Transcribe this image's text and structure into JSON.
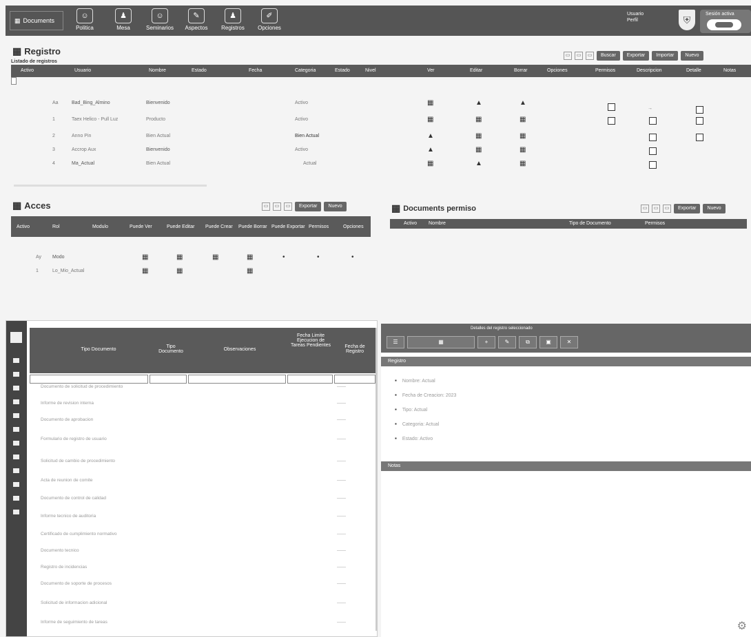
{
  "topbar": {
    "logo_label": "Documents",
    "nav": [
      {
        "label": "Politica",
        "icon": "chat-icon"
      },
      {
        "label": "Mesa",
        "icon": "user-icon"
      },
      {
        "label": "Seminarios",
        "icon": "chat-icon"
      },
      {
        "label": "Aspectos",
        "icon": "edit-icon"
      },
      {
        "label": "Registros",
        "icon": "user-icon"
      },
      {
        "label": "Opciones",
        "icon": "pencil-icon"
      }
    ],
    "right_text": [
      "Usuario",
      "Perfil"
    ],
    "user_label": "Sesión activa"
  },
  "registro": {
    "title": "Registro",
    "subtitle": "Listado de registros",
    "buttons": [
      "Buscar",
      "Exportar",
      "Importar",
      "Nuevo"
    ],
    "columns": [
      "Activo",
      "Usuario",
      "Nombre",
      "Estado",
      "Fecha",
      "Categoria",
      "Estado",
      "Nivel",
      "Ver",
      "Editar",
      "Borrar",
      "Opciones",
      "Permisos",
      "Descripcion",
      "Detalle",
      "Notas"
    ],
    "rows": [
      {
        "a": "Aa",
        "b": "Bad_Bing_Almino",
        "c": "Bienvenido",
        "d": "Activo"
      },
      {
        "a": "1",
        "b": "Taex Helico - Pull Luz",
        "c": "Producto",
        "d": "Activo"
      },
      {
        "a": "2",
        "b": "Anno Pin",
        "c": "Bien Actual",
        "d": "Bien Actual"
      },
      {
        "a": "3",
        "b": "Accrop Aux",
        "c": "Bienvenido",
        "d": "Activo"
      },
      {
        "a": "4",
        "b": "Ma_Actual",
        "c": "Bien Actual",
        "d": "Actual"
      }
    ]
  },
  "acces": {
    "title": "Acces",
    "buttons": [
      "Exportar",
      "Nuevo"
    ],
    "columns": [
      "Activo",
      "Rol",
      "Modulo",
      "Puede Ver",
      "Puede Editar",
      "Puede Crear",
      "Puede Borrar",
      "Puede Exportar",
      "Permisos",
      "Opciones"
    ],
    "rows": [
      {
        "a": "Ay",
        "b": "Modo"
      },
      {
        "a": "1",
        "b": "Lo_Mio_Actual"
      }
    ]
  },
  "documents": {
    "title": "Documents permiso",
    "buttons": [
      "Exportar",
      "Nuevo"
    ],
    "columns": [
      "Activo",
      "Nombre",
      "Tipo de Documento",
      "Permisos"
    ]
  },
  "grid": {
    "columns": [
      "Tipo Documento",
      "Tipo Documento",
      "Observaciones",
      "Fecha Limite Ejecucion de Tareas Pendientes",
      "Fecha de Registro"
    ],
    "rows": [
      "Documento de solicitud de procedimiento",
      "Informe de revision interna",
      "Documento de aprobacion",
      "Formulario de registro de usuario",
      "Solicitud de cambio de procedimiento",
      "Acta de reunion de comite",
      "Documento de control de calidad",
      "Informe tecnico de auditoria",
      "Certificado de cumplimiento normativo",
      "Documento tecnico",
      "Registro de incidencias",
      "Documento de soporte de procesos",
      "Solicitud de informacion adicional",
      "Informe de seguimiento de tareas"
    ]
  },
  "detail": {
    "header": "Detalles del registro seleccionado",
    "section1": "Registro",
    "items": [
      "Nombre: Actual",
      "Fecha de Creacion: 2023",
      "Tipo: Actual",
      "Categoria: Actual",
      "Estado: Activo"
    ],
    "section2": "Notas"
  }
}
